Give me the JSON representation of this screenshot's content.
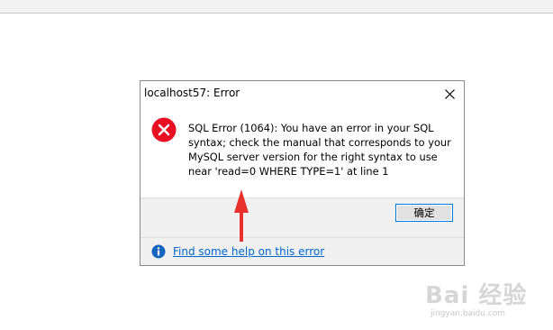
{
  "dialog": {
    "title": "localhost57: Error",
    "message": "SQL Error (1064): You have an error in your SQL syntax; check the manual that corresponds to your MySQL server version for the right syntax to use near 'read=0 WHERE TYPE=1' at line 1",
    "ok_label": "确定",
    "help_link": "Find some help on this error",
    "icons": {
      "error": "error-icon",
      "info": "info-icon",
      "close": "close-icon"
    }
  },
  "watermark": {
    "main": "Bai 经验",
    "sub": "jingyan.baidu.com"
  },
  "colors": {
    "error_red": "#e81123",
    "accent_blue": "#0078d7",
    "link_blue": "#0066cc",
    "arrow_red": "#e8302c"
  }
}
